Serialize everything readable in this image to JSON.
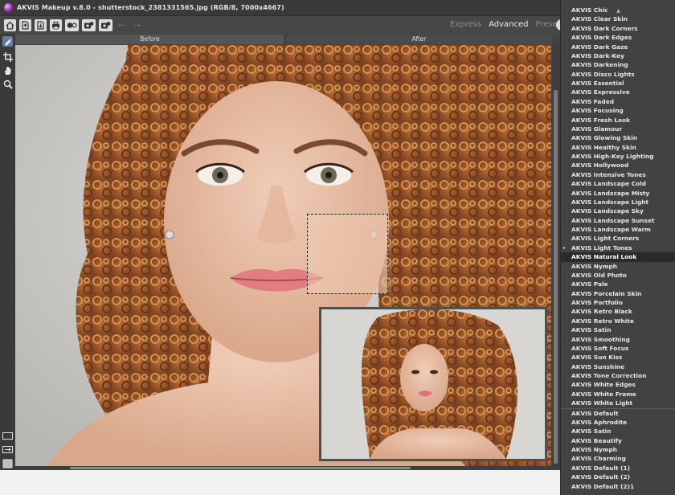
{
  "window": {
    "title": "AKVIS Makeup v.8.0 - shutterstock_2381331565.jpg (RGB/8, 7000x4667)"
  },
  "toolbar": {
    "tabs": [
      "Express",
      "Advanced",
      "Presets"
    ],
    "active_tab": "Advanced",
    "icons": [
      "home-icon",
      "open-file-icon",
      "save-file-icon",
      "print-icon",
      "share-icon",
      "batch-icon",
      "plugin-icon",
      "undo-icon",
      "redo-icon"
    ]
  },
  "tools": [
    "brush-icon",
    "crop-icon",
    "hand-icon",
    "zoom-icon"
  ],
  "view_modes": [
    "single-view-icon",
    "split-view-icon",
    "compare-view-icon"
  ],
  "view": {
    "before_label": "Before",
    "after_label": "After"
  },
  "presets": {
    "group1": [
      "AKVIS Chic",
      "AKVIS Clear Skin",
      "AKVIS Dark Corners",
      "AKVIS Dark Edges",
      "AKVIS Dark Gaze",
      "AKVIS Dark-Key",
      "AKVIS Darkening",
      "AKVIS Disco Lights",
      "AKVIS Essential",
      "AKVIS Expressive",
      "AKVIS Faded",
      "AKVIS Focusing",
      "AKVIS Fresh Look",
      "AKVIS Glamour",
      "AKVIS Glowing Skin",
      "AKVIS Healthy Skin",
      "AKVIS High-Key Lighting",
      "AKVIS Hollywood",
      "AKVIS Intensive Tones",
      "AKVIS Landscape Cold",
      "AKVIS Landscape Misty",
      "AKVIS Landscape Light",
      "AKVIS Landscape Sky",
      "AKVIS Landscape Sunset",
      "AKVIS Landscape Warm",
      "AKVIS Light Corners",
      "AKVIS Light Tones",
      "AKVIS Natural Look",
      "AKVIS Nymph",
      "AKVIS Old Photo",
      "AKVIS Pale",
      "AKVIS Porcelain Skin",
      "AKVIS Portfolio",
      "AKVIS Retro Black",
      "AKVIS Retro White",
      "AKVIS Satin",
      "AKVIS Smoothing",
      "AKVIS Soft Focus",
      "AKVIS Sun Kiss",
      "AKVIS Sunshine",
      "AKVIS Tone Correction",
      "AKVIS White Edges",
      "AKVIS White Frame",
      "AKVIS White Light"
    ],
    "group2": [
      "AKVIS Default",
      "AKVIS Aphrodite",
      "AKVIS Satin",
      "AKVIS Beautify",
      "AKVIS Nymph",
      "AKVIS Charming",
      "AKVIS Default (1)",
      "AKVIS Default (2)",
      "AKVIS Default (2)1"
    ],
    "selected": "AKVIS Natural Look",
    "marked": "AKVIS Light Tones"
  },
  "colors": {
    "panel_bg": "#424242",
    "selected_bg": "#2a2a2a",
    "hair": "#a8612e",
    "skin": "#e7bfa6",
    "backdrop": "#cdcbc7"
  }
}
